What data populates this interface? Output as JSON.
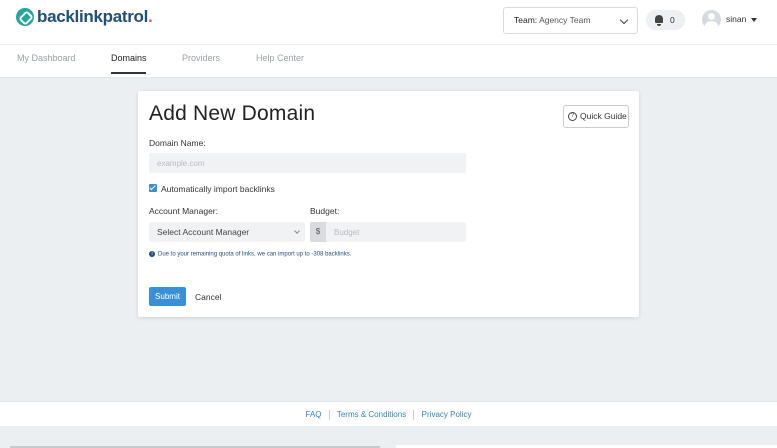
{
  "brand": {
    "name": "backlinkpatrol",
    "dot": "."
  },
  "header": {
    "team_label": "Team:",
    "team_value": "Agency Team",
    "notification_count": "0",
    "user_name": "sinan"
  },
  "nav": {
    "tabs": [
      {
        "label": "My Dashboard"
      },
      {
        "label": "Domains"
      },
      {
        "label": "Providers"
      },
      {
        "label": "Help Center"
      }
    ],
    "active": "Domains"
  },
  "form": {
    "title": "Add New Domain",
    "quick_guide_label": "Quick Guide",
    "domain_label": "Domain Name:",
    "domain_placeholder": "example.com",
    "domain_value": "",
    "auto_import_label": "Automatically import backlinks",
    "auto_import_checked": true,
    "account_manager_label": "Account Manager:",
    "account_manager_value": "Select Account Manager",
    "budget_label": "Budget:",
    "budget_currency": "$",
    "budget_placeholder": "Budget",
    "info_text": "Due to your remaining quota of links, we can import up to -308 backlinks.",
    "submit_label": "Submit",
    "cancel_label": "Cancel"
  },
  "footer": {
    "links": [
      {
        "label": "FAQ"
      },
      {
        "label": "Terms & Conditions"
      },
      {
        "label": "Privacy Policy"
      }
    ]
  },
  "colors": {
    "accent": "#3a8fd6",
    "brand": "#25a5a0",
    "brand_text": "#1f4f7a",
    "link": "#2f86c8"
  }
}
